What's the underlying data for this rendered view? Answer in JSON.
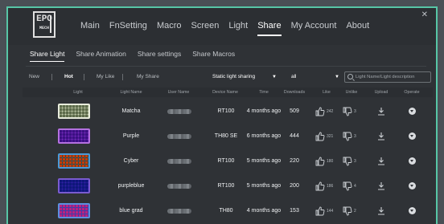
{
  "nav": {
    "logo_text": "EPO",
    "logo_sub": "MECH",
    "items": [
      "Main",
      "FnSetting",
      "Macro",
      "Screen",
      "Light",
      "Share",
      "My Account",
      "About"
    ],
    "active": "Share"
  },
  "window_close": "✕",
  "subtabs": {
    "items": [
      "Share Light",
      "Share Animation",
      "Share settings",
      "Share Macros"
    ],
    "active": "Share Light"
  },
  "filters": {
    "new": "New",
    "hot": "Hot",
    "my_like": "My Like",
    "my_share": "My Share",
    "share_type": "Static light sharing",
    "device": "all",
    "arrow": "▼",
    "search_placeholder": "Light Name/Light description"
  },
  "table": {
    "headers": [
      "Light",
      "Light Name",
      "User Name",
      "Device Name",
      "Time",
      "Downloads",
      "Like",
      "Unlike",
      "Upload",
      "Operate"
    ],
    "rows": [
      {
        "name": "Matcha",
        "device": "RT100",
        "time": "4 months ago",
        "downloads": "509",
        "likes": "242",
        "unlikes": "3",
        "kb_bg": "#e8ecdc",
        "kb_keys": "#9aa58a"
      },
      {
        "name": "Purple",
        "device": "TH80 SE",
        "time": "6 months ago",
        "downloads": "444",
        "likes": "321",
        "unlikes": "3",
        "kb_bg": "#b470e0",
        "kb_keys": "#7b3fb6"
      },
      {
        "name": "Cyber",
        "device": "RT100",
        "time": "5 months ago",
        "downloads": "220",
        "likes": "180",
        "unlikes": "3",
        "kb_bg": "#4a9ad8",
        "kb_keys": "#e07a3a"
      },
      {
        "name": "purpleblue",
        "device": "RT100",
        "time": "5 months ago",
        "downloads": "200",
        "likes": "186",
        "unlikes": "4",
        "kb_bg": "#7a5bd0",
        "kb_keys": "#3d4bb0"
      },
      {
        "name": "blue grad",
        "device": "TH80",
        "time": "4 months ago",
        "downloads": "153",
        "likes": "144",
        "unlikes": "2",
        "kb_bg": "#5c8fe0",
        "kb_keys": "#d95fb5"
      }
    ]
  },
  "colors": {
    "accent": "#57c6a6",
    "window_bg": "#2f3236",
    "page_bg": "#4a4f55"
  },
  "icons": {
    "like": "thumb-up-icon",
    "unlike": "thumb-down-icon",
    "upload": "download-icon",
    "operate": "more-circle-icon",
    "search": "search-icon"
  }
}
